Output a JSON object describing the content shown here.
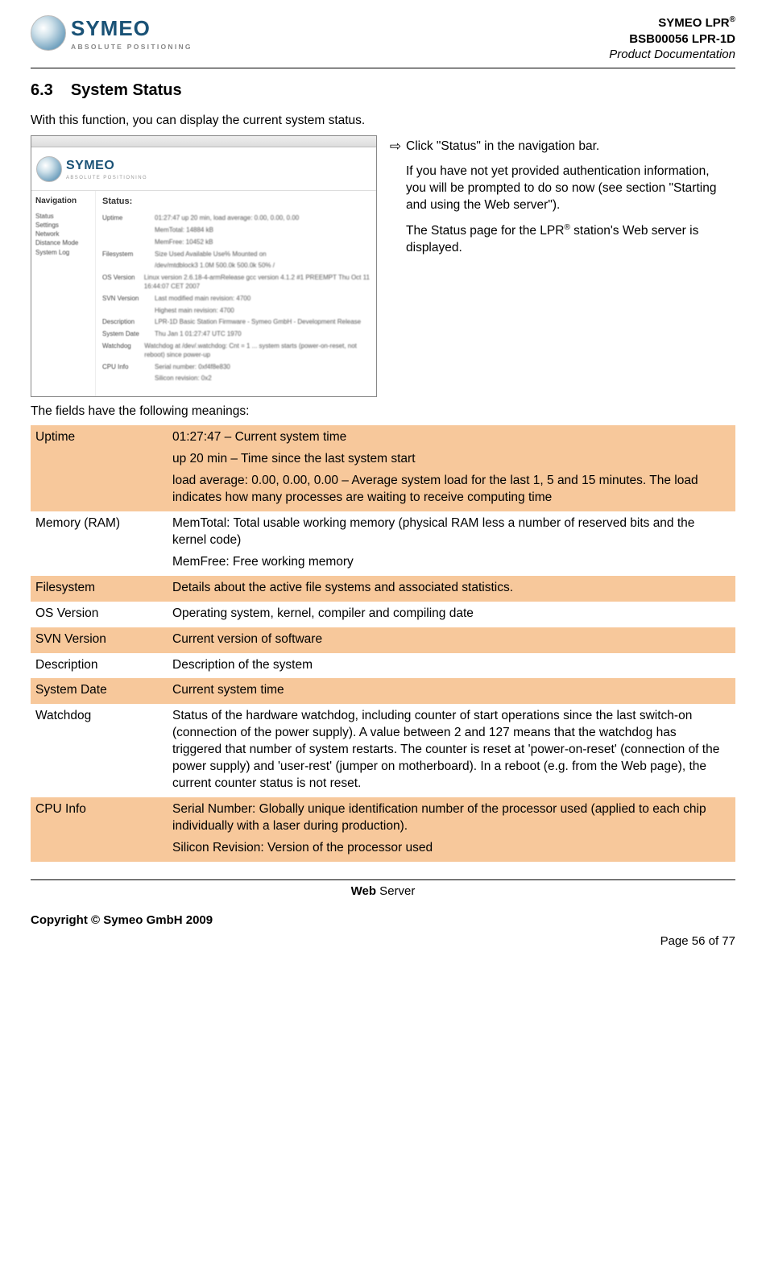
{
  "header": {
    "logo_name": "SYMEO",
    "logo_tag": "ABSOLUTE POSITIONING",
    "product_line1_pre": "SYMEO LPR",
    "product_line1_sup": "®",
    "product_line2": "BSB00056 LPR-1D",
    "product_line3": "Product Documentation"
  },
  "section": {
    "number": "6.3",
    "title": "System Status"
  },
  "intro": "With this function, you can display the current system status.",
  "screenshot": {
    "nav_title": "Navigation",
    "content_title": "Status:",
    "nav_items": [
      "Status",
      "Settings",
      "Network",
      "Distance Mode",
      "System Log"
    ],
    "rows": [
      {
        "label": "Uptime",
        "value": "01:27:47 up 20 min, load average: 0.00, 0.00, 0.00"
      },
      {
        "label": "",
        "value": "MemTotal: 14884 kB"
      },
      {
        "label": "",
        "value": "MemFree: 10452 kB"
      },
      {
        "label": "Filesystem",
        "value": "Size    Used    Available Use% Mounted on"
      },
      {
        "label": "",
        "value": "/dev/mtdblock3 1.0M  500.0k 500.0k 50% /"
      },
      {
        "label": "OS Version",
        "value": "Linux version 2.6.18-4-armRelease gcc version 4.1.2 #1 PREEMPT Thu Oct 11 16:44:07 CET 2007"
      },
      {
        "label": "SVN Version",
        "value": "Last modified main revision: 4700"
      },
      {
        "label": "",
        "value": "Highest main revision: 4700"
      },
      {
        "label": "Description",
        "value": "LPR-1D  Basic Station Firmware - Symeo GmbH - Development Release"
      },
      {
        "label": "System Date",
        "value": "Thu Jan 1 01:27:47 UTC 1970"
      },
      {
        "label": "Watchdog",
        "value": "Watchdog at /dev/.watchdog: Cnt = 1 ... system starts (power-on-reset, not reboot) since power-up"
      },
      {
        "label": "CPU Info",
        "value": "Serial number: 0xf4f8e830"
      },
      {
        "label": "",
        "value": "Silicon revision: 0x2"
      }
    ]
  },
  "instructions": {
    "step1a": "Click \"Status\" in the navigation bar.",
    "step1b": "If you have not yet provided authentication information, you will be prompted to do so now (see section \"Starting and using the Web server\").",
    "step1c_pre": "The Status page for the LPR",
    "step1c_sup": "®",
    "step1c_post": " station's Web server is displayed."
  },
  "fields_intro": "The fields have the following meanings:",
  "field_table": [
    {
      "name": "Uptime",
      "paras": [
        "01:27:47 – Current system time",
        "up 20 min – Time since the last system start",
        "load average: 0.00, 0.00, 0.00 – Average system load for the last 1, 5 and 15 minutes. The load indicates how many processes are waiting to receive computing time"
      ]
    },
    {
      "name": "Memory (RAM)",
      "paras": [
        "MemTotal: Total usable working memory (physical RAM less a number of reserved bits and the kernel code)",
        "MemFree: Free working memory"
      ]
    },
    {
      "name": "Filesystem",
      "paras": [
        "Details about the active file systems and associated statistics."
      ]
    },
    {
      "name": "OS Version",
      "paras": [
        "Operating system, kernel, compiler and compiling date"
      ]
    },
    {
      "name": "SVN Version",
      "paras": [
        "Current version of software"
      ]
    },
    {
      "name": "Description",
      "paras": [
        "Description of the system"
      ]
    },
    {
      "name": "System Date",
      "paras": [
        "Current system time"
      ]
    },
    {
      "name": "Watchdog",
      "paras": [
        "Status of the hardware watchdog, including counter of start operations since the last switch-on (connection of the power supply). A value between 2 and 127 means that the watchdog has triggered that number of system restarts. The counter is reset at 'power-on-reset' (connection of the power supply) and 'user-rest' (jumper on motherboard). In a reboot (e.g. from the Web page), the current counter status is not reset."
      ]
    },
    {
      "name": "CPU Info",
      "paras": [
        "Serial Number: Globally unique identification number of the processor used (applied to each chip individually with a laser during production).",
        "Silicon Revision: Version of the processor used"
      ]
    }
  ],
  "footer": {
    "section_bold": "Web",
    "section_rest": " Server",
    "copyright": "Copyright © Symeo GmbH 2009",
    "page": "Page 56 of 77"
  }
}
